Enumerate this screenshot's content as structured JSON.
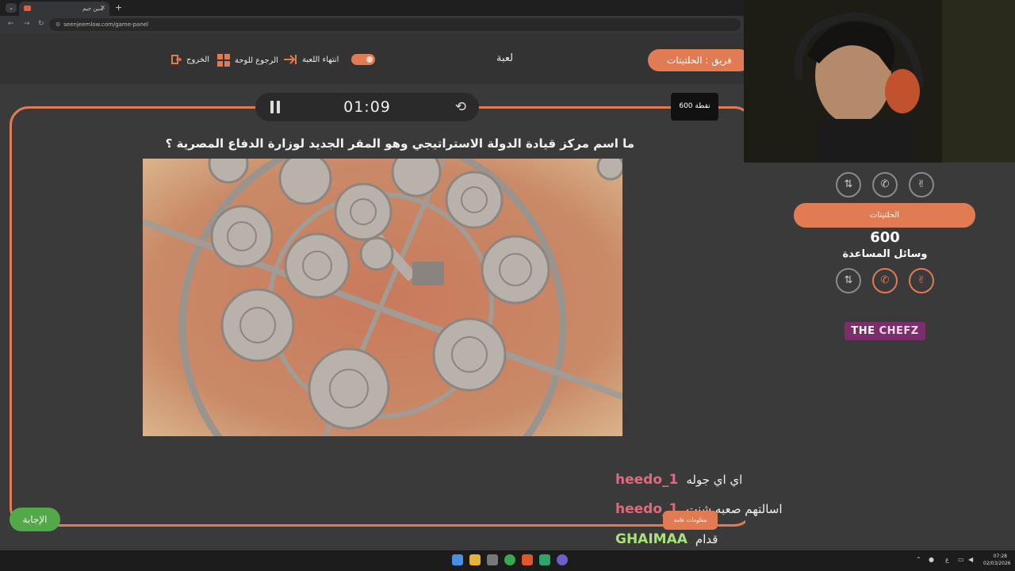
{
  "browser": {
    "tab_title": "سين جيم",
    "url": "seenjeemlow.com/game-panel"
  },
  "header": {
    "exit_label": "الخروج",
    "back_label": "الرجوع للوحة",
    "end_game_label": "انتهاء اللعبة",
    "game_title": "لعبة",
    "team_label": "فريق : الحلتيتات"
  },
  "game": {
    "timer": "01:09",
    "points": "600 نقطة",
    "question": "ما اسم مركز قيادة الدولة الاستراتيجي وهو المقر الجديد لوزارة الدفاع المصرية ؟",
    "answer_label": "الإجابة"
  },
  "side": {
    "team_name": "الحلتيتات",
    "score": "600",
    "aids_label": "وسائل المساعدة",
    "logo_the": "THE",
    "logo_chefz": "CHEFZ"
  },
  "chat": [
    {
      "user": "heedo_1",
      "message": "اي اي جوله",
      "color": "#e2687f"
    },
    {
      "user": "heedo_1",
      "message": "اسالتهم صعبه شنت",
      "color": "#e2687f"
    },
    {
      "user": "GHAIMAA",
      "message": "قدام",
      "color": "#a8e27a"
    }
  ],
  "info_tag": "معلومات عامة",
  "taskbar": {
    "lang": "ع",
    "time": "07:28",
    "date": "02/03/2026"
  },
  "colors": {
    "accent": "#e07b53",
    "answer": "#53a847"
  }
}
